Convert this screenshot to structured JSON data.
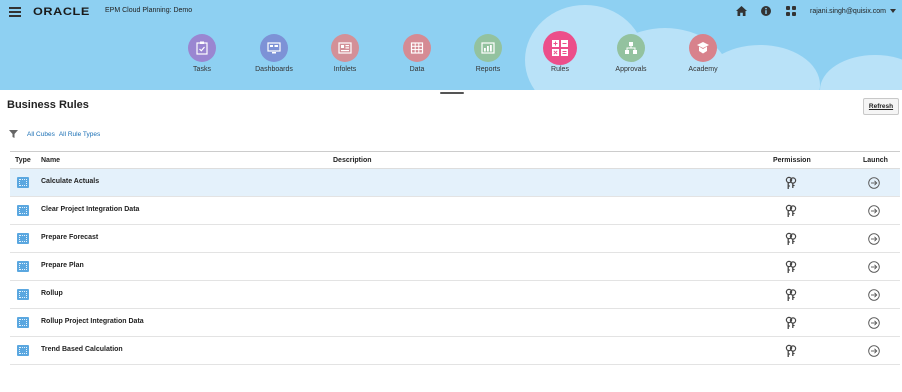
{
  "header": {
    "logo": "ORACLE",
    "app_title": "EPM Cloud Planning: Demo",
    "user": "rajani.singh@quisix.com",
    "icons": [
      "home-icon",
      "info-icon",
      "grid-icon"
    ]
  },
  "nav": [
    {
      "label": "Tasks",
      "icon": "tasks-icon",
      "color": "#9a86d1",
      "active": false
    },
    {
      "label": "Dashboards",
      "icon": "dashboards-icon",
      "color": "#7d92d6",
      "active": false
    },
    {
      "label": "Infolets",
      "icon": "infolets-icon",
      "color": "#d39098",
      "active": false
    },
    {
      "label": "Data",
      "icon": "data-icon",
      "color": "#d58b94",
      "active": false
    },
    {
      "label": "Reports",
      "icon": "reports-icon",
      "color": "#93c29f",
      "active": false
    },
    {
      "label": "Rules",
      "icon": "rules-icon",
      "color": "#ec4e8a",
      "active": true
    },
    {
      "label": "Approvals",
      "icon": "approvals-icon",
      "color": "#93c29f",
      "active": false
    },
    {
      "label": "Academy",
      "icon": "academy-icon",
      "color": "#d8828c",
      "active": false
    }
  ],
  "page": {
    "title": "Business Rules",
    "refresh_label": "Refresh"
  },
  "filters": {
    "cubes": "All Cubes",
    "rule_types": "All Rule Types"
  },
  "table": {
    "headers": {
      "type": "Type",
      "name": "Name",
      "description": "Description",
      "permission": "Permission",
      "launch": "Launch"
    },
    "rows": [
      {
        "name": "Calculate Actuals",
        "description": "",
        "selected": true
      },
      {
        "name": "Clear Project Integration Data",
        "description": "",
        "selected": false
      },
      {
        "name": "Prepare Forecast",
        "description": "",
        "selected": false
      },
      {
        "name": "Prepare Plan",
        "description": "",
        "selected": false
      },
      {
        "name": "Rollup",
        "description": "",
        "selected": false
      },
      {
        "name": "Rollup Project Integration Data",
        "description": "",
        "selected": false
      },
      {
        "name": "Trend Based Calculation",
        "description": "",
        "selected": false
      }
    ]
  },
  "colors": {
    "header_bg": "#8ed0f2",
    "selected_row": "#e4f1fb",
    "link": "#1a6fb5",
    "rule_icon": "#5aa7e0"
  }
}
